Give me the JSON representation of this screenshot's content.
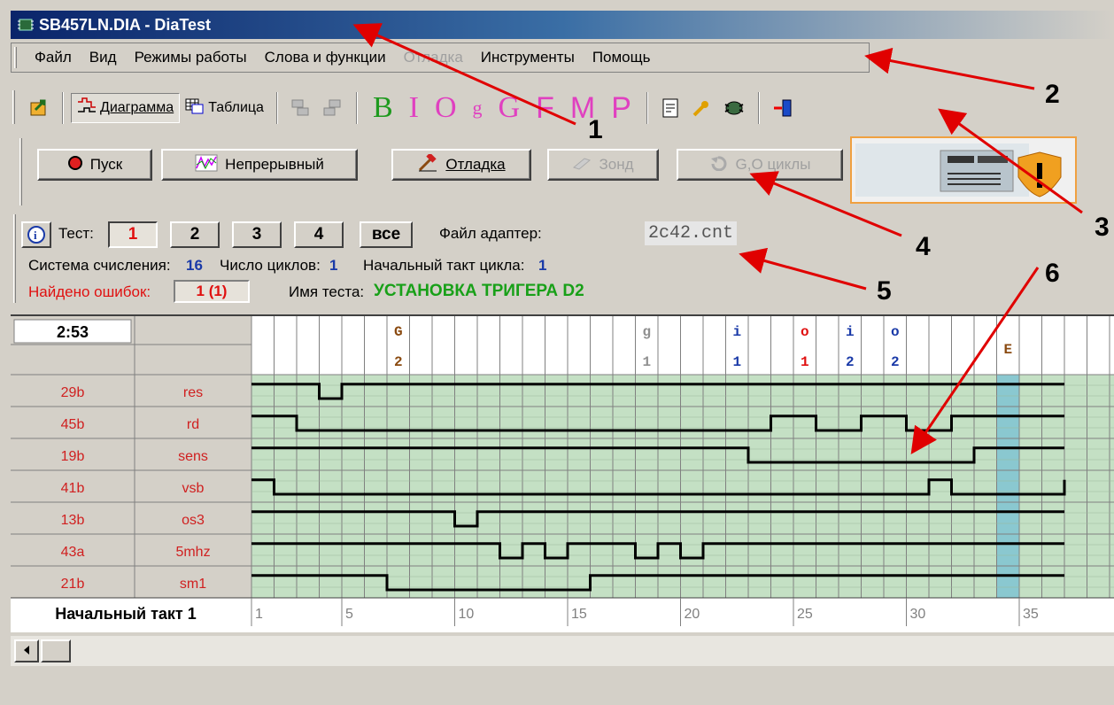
{
  "window": {
    "title": "SB457LN.DIA - DiaTest"
  },
  "menu": [
    {
      "label": "Файл",
      "disabled": false
    },
    {
      "label": "Вид",
      "disabled": false
    },
    {
      "label": "Режимы работы",
      "disabled": false
    },
    {
      "label": "Слова и функции",
      "disabled": false
    },
    {
      "label": "Отладка",
      "disabled": true
    },
    {
      "label": "Инструменты",
      "disabled": false
    },
    {
      "label": "Помощь",
      "disabled": false
    }
  ],
  "toolbar": {
    "diagram_label": "Диаграмма",
    "table_label": "Таблица",
    "letters": [
      {
        "text": "B",
        "color": "#1e9a1e"
      },
      {
        "text": "I",
        "color": "#e040c0"
      },
      {
        "text": "O",
        "color": "#e040c0"
      },
      {
        "text": "g",
        "color": "#e040c0"
      },
      {
        "text": "G",
        "color": "#e040c0"
      },
      {
        "text": "F",
        "color": "#e040c0"
      },
      {
        "text": "M",
        "color": "#e040c0"
      },
      {
        "text": "P",
        "color": "#e040c0"
      }
    ]
  },
  "actions": {
    "start": "Пуск",
    "continuous": "Непрерывный",
    "debug": "Отладка",
    "probe": "Зонд",
    "cycles": "G,O циклы"
  },
  "info": {
    "test_label": "Тест:",
    "tests": [
      "1",
      "2",
      "3",
      "4",
      "все"
    ],
    "adapter_label": "Файл адаптер:",
    "adapter_value": "2c42.cnt",
    "radix_label": "Система счисления:",
    "radix_value": "16",
    "cycles_label": "Число циклов:",
    "cycles_value": "1",
    "start_tact_label": "Начальный такт цикла:",
    "start_tact_value": "1",
    "errors_label": "Найдено ошибок:",
    "errors_value": "1 (1)",
    "test_name_label": "Имя теста:",
    "test_name_value": "УСТАНОВКА ТРИГЕРА D2"
  },
  "diagram": {
    "time": "2:53",
    "footer_label": "Начальный такт 1",
    "x_ticks": [
      "1",
      "5",
      "10",
      "15",
      "20",
      "25",
      "30",
      "35"
    ],
    "markers": [
      {
        "col": 6,
        "top": "G",
        "bottom": "2",
        "color": "#8a4a10"
      },
      {
        "col": 17,
        "top": "g",
        "bottom": "1",
        "color": "#909090"
      },
      {
        "col": 21,
        "top": "i",
        "bottom": "1",
        "color": "#1a3aa8"
      },
      {
        "col": 24,
        "top": "o",
        "bottom": "1",
        "color": "#e01010"
      },
      {
        "col": 26,
        "top": "i",
        "bottom": "2",
        "color": "#1a3aa8"
      },
      {
        "col": 28,
        "top": "o",
        "bottom": "2",
        "color": "#1a3aa8"
      },
      {
        "col": 33,
        "top": "E",
        "bottom": "",
        "color": "#8a4a10"
      }
    ],
    "signals": [
      {
        "pin": "29b",
        "name": "res",
        "segments": [
          [
            0,
            1
          ],
          [
            3,
            0
          ],
          [
            4,
            1
          ]
        ]
      },
      {
        "pin": "45b",
        "name": "rd",
        "segments": [
          [
            0,
            1
          ],
          [
            2,
            0
          ],
          [
            23,
            1
          ],
          [
            25,
            0
          ],
          [
            27,
            1
          ],
          [
            29,
            0
          ],
          [
            31,
            1
          ]
        ]
      },
      {
        "pin": "19b",
        "name": "sens",
        "segments": [
          [
            0,
            1
          ],
          [
            22,
            0
          ],
          [
            32,
            1
          ]
        ]
      },
      {
        "pin": "41b",
        "name": "vsb",
        "segments": [
          [
            0,
            1
          ],
          [
            1,
            0
          ],
          [
            30,
            1
          ],
          [
            31,
            0
          ],
          [
            36,
            1
          ]
        ]
      },
      {
        "pin": "13b",
        "name": "os3",
        "segments": [
          [
            0,
            1
          ],
          [
            9,
            0
          ],
          [
            10,
            1
          ]
        ]
      },
      {
        "pin": "43a",
        "name": "5mhz",
        "segments": [
          [
            0,
            1
          ],
          [
            11,
            0
          ],
          [
            12,
            1
          ],
          [
            13,
            0
          ],
          [
            14,
            1
          ],
          [
            17,
            0
          ],
          [
            18,
            1
          ],
          [
            19,
            0
          ],
          [
            20,
            1
          ]
        ]
      },
      {
        "pin": "21b",
        "name": "sm1",
        "segments": [
          [
            0,
            1
          ],
          [
            6,
            0
          ],
          [
            15,
            1
          ]
        ]
      }
    ],
    "total_cols": 37,
    "highlight_col": 33
  },
  "annotations": [
    "1",
    "2",
    "3",
    "4",
    "5",
    "6"
  ]
}
